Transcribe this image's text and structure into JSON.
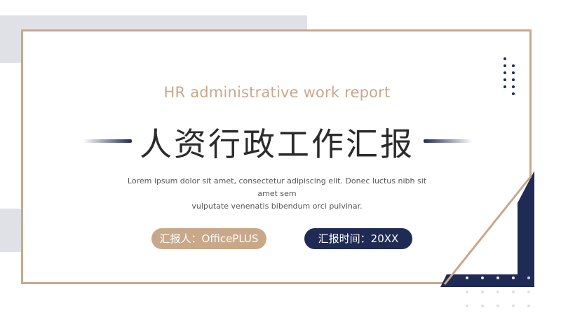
{
  "slide": {
    "subtitle": "HR administrative work report",
    "title": "人资行政工作汇报",
    "description_line1": "Lorem ipsum dolor sit amet, consectetur adipiscing elit. Donec luctus nibh sit amet sem",
    "description_line2": "vulputate venenatis bibendum orci pulvinar.",
    "reporter_label": "汇报人：OfficePLUS",
    "time_label": "汇报时间：20XX"
  },
  "colors": {
    "accent_tan": "#c9a88a",
    "navy": "#1f2b54",
    "gray_block": "#dfe1e6",
    "title_text": "#2b2b2b"
  }
}
